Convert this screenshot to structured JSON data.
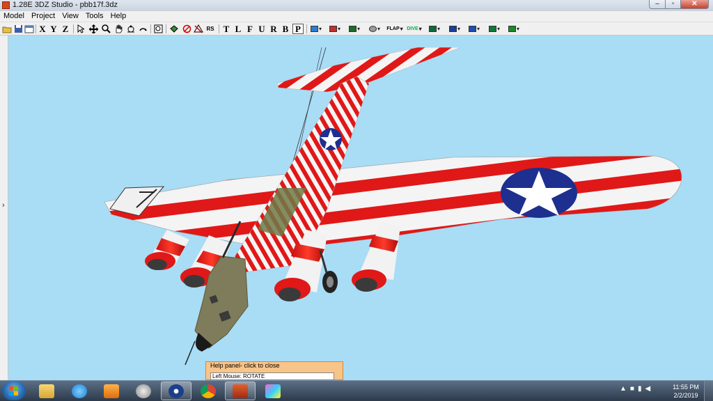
{
  "window": {
    "title": "1.28E 3DZ Studio - pbb17f.3dz",
    "min": "‒",
    "max": "▫",
    "close": "✕"
  },
  "menu": [
    "Model",
    "Project",
    "View",
    "Tools",
    "Help"
  ],
  "toolbar": {
    "axis_x": "X",
    "axis_y": "Y",
    "axis_z": "Z",
    "rs": "RS",
    "views": [
      "T",
      "L",
      "F",
      "U",
      "R",
      "B",
      "P"
    ],
    "flap": "FLAP",
    "dive": "DIVE"
  },
  "sidebar": {
    "toggle": "›"
  },
  "help_panel": {
    "title": "Help panel- click to close",
    "text": "Left Mouse: ROTATE"
  },
  "clock": {
    "time": "11:55 PM",
    "date": "2/2/2019"
  },
  "colors": {
    "sky": "#a9dcf5",
    "stripe_red": "#e01818",
    "olive": "#7e7c5a",
    "roundel_blue": "#1d2f8f"
  }
}
